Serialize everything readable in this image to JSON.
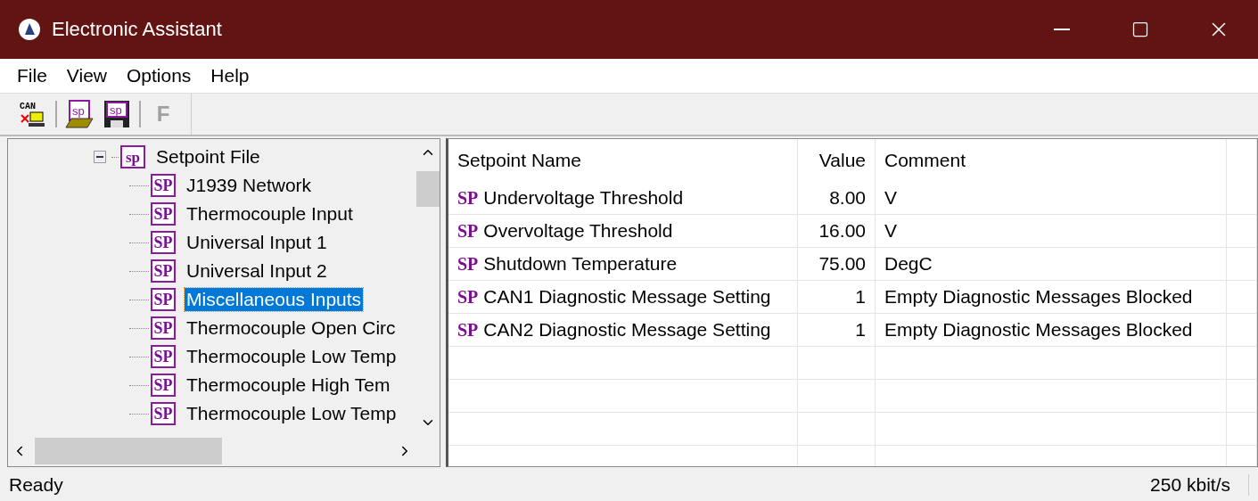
{
  "window": {
    "title": "Electronic Assistant"
  },
  "menu": [
    "File",
    "View",
    "Options",
    "Help"
  ],
  "toolbar": [
    {
      "kind": "can",
      "label": "CAN"
    },
    {
      "kind": "separator"
    },
    {
      "kind": "open",
      "label": "sp"
    },
    {
      "kind": "save",
      "label": "sp"
    },
    {
      "kind": "separator"
    },
    {
      "kind": "letter",
      "label": "F",
      "disabled": true
    }
  ],
  "tree": {
    "root": {
      "label": "Setpoint File",
      "icon_label": "sp",
      "expanded": true,
      "children": [
        {
          "label": "J1939 Network",
          "icon_label": "SP",
          "selected": false
        },
        {
          "label": "Thermocouple Input",
          "icon_label": "SP",
          "selected": false
        },
        {
          "label": "Universal Input 1",
          "icon_label": "SP",
          "selected": false
        },
        {
          "label": "Universal Input 2",
          "icon_label": "SP",
          "selected": false
        },
        {
          "label": "Miscellaneous Inputs",
          "icon_label": "SP",
          "selected": true
        },
        {
          "label": "Thermocouple Open Circ",
          "icon_label": "SP",
          "selected": false
        },
        {
          "label": "Thermocouple Low Temp",
          "icon_label": "SP",
          "selected": false
        },
        {
          "label": "Thermocouple High Tem",
          "icon_label": "SP",
          "selected": false
        },
        {
          "label": "Thermocouple Low Temp",
          "icon_label": "SP",
          "selected": false
        }
      ]
    }
  },
  "table": {
    "columns": [
      "Setpoint Name",
      "Value",
      "Comment"
    ],
    "rows": [
      {
        "marker": "SP",
        "name": "Undervoltage Threshold",
        "value": "8.00",
        "comment": "V"
      },
      {
        "marker": "SP",
        "name": "Overvoltage Threshold",
        "value": "16.00",
        "comment": "V"
      },
      {
        "marker": "SP",
        "name": "Shutdown Temperature",
        "value": "75.00",
        "comment": "DegC"
      },
      {
        "marker": "SP",
        "name": "CAN1 Diagnostic Message Setting",
        "value": "1",
        "comment": "Empty Diagnostic Messages Blocked"
      },
      {
        "marker": "SP",
        "name": "CAN2 Diagnostic Message Setting",
        "value": "1",
        "comment": "Empty Diagnostic Messages Blocked"
      }
    ]
  },
  "status_bar": {
    "message": "Ready",
    "bitrate": "250 kbit/s"
  }
}
